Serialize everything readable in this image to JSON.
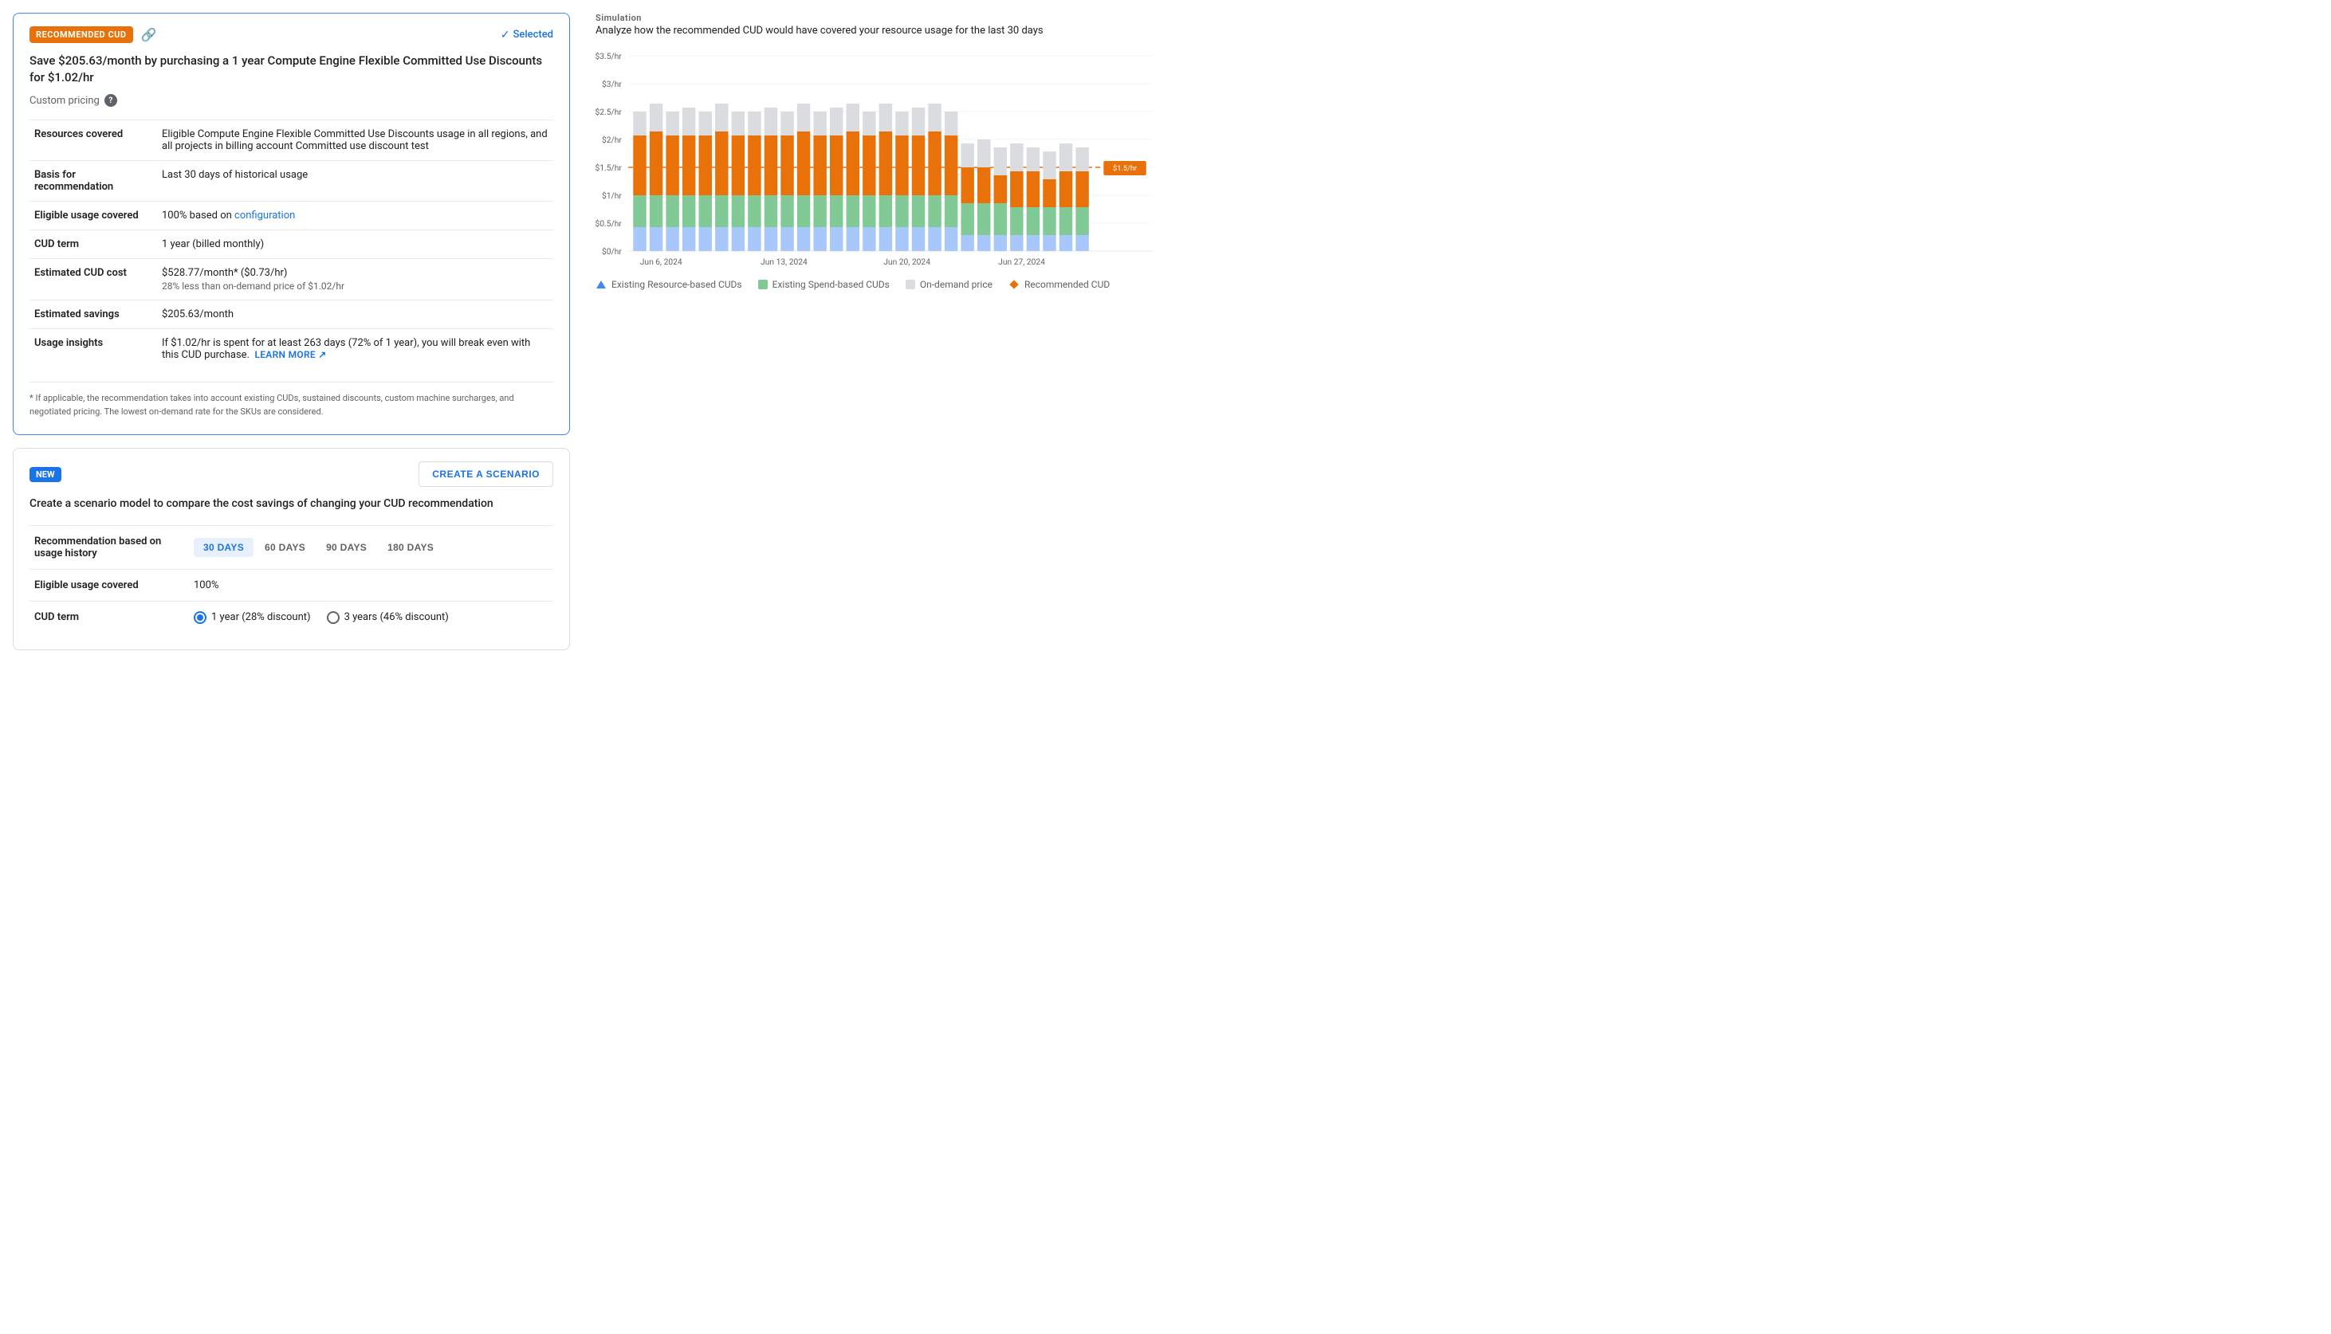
{
  "recommendation": {
    "badge_label": "RECOMMENDED CUD",
    "selected_label": "Selected",
    "title": "Save $205.63/month by purchasing a 1 year Compute Engine Flexible Committed Use Discounts for $1.02/hr",
    "custom_pricing_label": "Custom pricing",
    "details": [
      {
        "key": "resources_covered_label",
        "label": "Resources covered",
        "value": "Eligible Compute Engine Flexible Committed Use Discounts usage in all regions, and all projects in billing account Committed use discount test"
      },
      {
        "key": "basis_label",
        "label": "Basis for recommendation",
        "value": "Last 30 days of historical usage"
      },
      {
        "key": "eligible_label",
        "label": "Eligible usage covered",
        "value": "100% based on ",
        "link": "configuration"
      },
      {
        "key": "cud_term_label",
        "label": "CUD term",
        "value": "1 year (billed monthly)"
      },
      {
        "key": "cud_cost_label",
        "label": "Estimated CUD cost",
        "value": "$528.77/month* ($0.73/hr)",
        "sub_value": "28% less than on-demand price of $1.02/hr"
      },
      {
        "key": "savings_label",
        "label": "Estimated savings",
        "value": "$205.63/month"
      },
      {
        "key": "usage_label",
        "label": "Usage insights",
        "value": "If $1.02/hr is spent for at least 263 days (72% of 1 year), you will break even with this CUD purchase.",
        "learn_more": "LEARN MORE"
      }
    ],
    "footnote": "* If applicable, the recommendation takes into account existing CUDs, sustained discounts, custom machine surcharges, and negotiated pricing. The lowest on-demand rate for the SKUs are considered."
  },
  "scenario": {
    "badge_label": "NEW",
    "create_btn_label": "CREATE A SCENARIO",
    "title": "Create a scenario model to compare the cost savings of changing your CUD recommendation",
    "recommendation_label": "Recommendation based on usage history",
    "days_tabs": [
      "30 DAYS",
      "60 DAYS",
      "90 DAYS",
      "180 DAYS"
    ],
    "active_day_tab": 0,
    "eligible_label": "Eligible usage covered",
    "eligible_value": "100%",
    "cud_term_label": "CUD term",
    "radio_options": [
      {
        "label": "1 year (28% discount)",
        "selected": true
      },
      {
        "label": "3 years (46% discount)",
        "selected": false
      }
    ]
  },
  "simulation": {
    "section_label": "Simulation",
    "subtitle": "Analyze how the recommended CUD would have covered your resource usage for the last 30 days",
    "y_axis_labels": [
      "$3.5/hr",
      "$3/hr",
      "$2.5/hr",
      "$2/hr",
      "$1.5/hr",
      "$1/hr",
      "$0.5/hr",
      "$0/hr"
    ],
    "x_axis_labels": [
      "Jun 6, 2024",
      "Jun 13, 2024",
      "Jun 20, 2024",
      "Jun 27, 2024"
    ],
    "recommended_cud_label": "$1.5/hr",
    "legend": [
      {
        "label": "Existing Resource-based CUDs",
        "type": "triangle",
        "color": "#4285f4"
      },
      {
        "label": "Existing Spend-based CUDs",
        "type": "square",
        "color": "#34a853"
      },
      {
        "label": "On-demand price",
        "type": "square",
        "color": "#dadce0"
      },
      {
        "label": "Recommended CUD",
        "type": "diamond",
        "color": "#e8710a"
      }
    ]
  }
}
